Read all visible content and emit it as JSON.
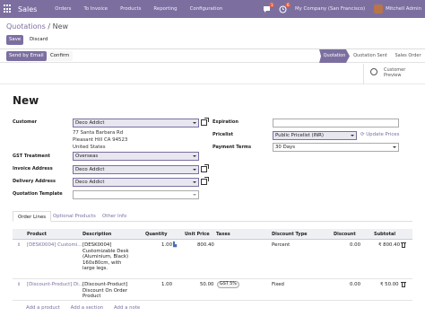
{
  "topnav": {
    "brand": "Sales",
    "menu": [
      "Orders",
      "To Invoice",
      "Products",
      "Reporting",
      "Configuration"
    ],
    "chat_count": "1",
    "activity_count": "6",
    "company": "My Company (San Francisco)",
    "user": "Mitchell Admin"
  },
  "breadcrumb": {
    "parent": "Quotations",
    "separator": "/",
    "current": "New"
  },
  "actions": {
    "save": "Save",
    "discard": "Discard"
  },
  "statusbar": {
    "send_email": "Send by Email",
    "confirm": "Confirm",
    "stages": [
      "Quotation",
      "Quotation Sent",
      "Sales Order"
    ],
    "active_stage": "Quotation"
  },
  "button_box": {
    "customer_preview_line1": "Customer",
    "customer_preview_line2": "Preview"
  },
  "form": {
    "title": "New",
    "customer_label": "Customer",
    "customer": "Deco Addict",
    "address": [
      "77 Santa Barbara Rd",
      "Pleasant Hill CA 94523",
      "United States"
    ],
    "gst_treatment_label": "GST Treatment",
    "gst_treatment": "Overseas",
    "invoice_address_label": "Invoice Address",
    "invoice_address": "Deco Addict",
    "delivery_address_label": "Delivery Address",
    "delivery_address": "Deco Addict",
    "template_label": "Quotation Template",
    "template": "",
    "expiration_label": "Expiration",
    "expiration": "",
    "pricelist_label": "Pricelist",
    "pricelist": "Public Pricelist (INR)",
    "update_prices": "Update Prices",
    "payment_terms_label": "Payment Terms",
    "payment_terms": "30 Days"
  },
  "tabs": [
    "Order Lines",
    "Optional Products",
    "Other Info"
  ],
  "table": {
    "headers": {
      "product": "Product",
      "description": "Description",
      "quantity": "Quantity",
      "unit_price": "Unit Price",
      "taxes": "Taxes",
      "discount_type": "Discount Type",
      "discount": "Discount",
      "subtotal": "Subtotal"
    },
    "rows": [
      {
        "product": "[DESK0004] Customi...",
        "description": [
          "[DESK0004]",
          "Customizable Desk",
          "(Aluminium, Black)",
          "160x80cm, with",
          "large legs."
        ],
        "quantity": "1.00",
        "unit_price": "800.40",
        "taxes": "",
        "discount_type": "Percent",
        "discount": "0.00",
        "subtotal": "₹ 800.40"
      },
      {
        "product": "[Discount-Product] Di...",
        "description": [
          "[Discount-Product]",
          "Discount On Order",
          "Product"
        ],
        "quantity": "1.00",
        "unit_price": "50.00",
        "taxes": "GST 5%",
        "discount_type": "Fixed",
        "discount": "0.00",
        "subtotal": "₹ 50.00"
      }
    ],
    "add_links": [
      "Add a product",
      "Add a section",
      "Add a note"
    ]
  }
}
